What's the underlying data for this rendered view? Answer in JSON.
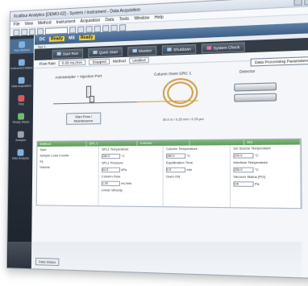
{
  "window": {
    "title": "Xcalibur Analytics [DEMO-02] - System / Instrument - Data Acquisition",
    "menu": [
      "File",
      "View",
      "Method",
      "Instrument",
      "Acquisition",
      "Data",
      "Tools",
      "Window",
      "Help"
    ]
  },
  "sidebar": {
    "items": [
      {
        "label": "New Method",
        "icon": "document-icon"
      },
      {
        "label": "Instrument Status",
        "icon": "instrument-icon"
      },
      {
        "label": "Data Acquisition",
        "icon": "acquisition-icon"
      },
      {
        "label": "Stop",
        "icon": "stop-icon"
      },
      {
        "label": "Ready Status",
        "icon": "status-icon"
      },
      {
        "label": "Analysis",
        "icon": "analysis-icon"
      },
      {
        "label": "Data Analysis",
        "icon": "chart-icon"
      }
    ]
  },
  "status": {
    "prefix": "DC",
    "state1": "Ready",
    "mid": "MS",
    "state2": "Ready",
    "sub": "Sys 1"
  },
  "buttons": {
    "run": "Start Run",
    "quick": "Quick Start",
    "monitor": "Monitor",
    "shutdown": "Shutdown",
    "check": "System Check"
  },
  "info": {
    "flow_label": "Flow Rate",
    "flow_value": "0.00 mL/min",
    "state_label": "Stopped",
    "method_label": "Method",
    "method_value": "Untitled"
  },
  "data_processing_button": "Data Processing Parameters...",
  "diagram": {
    "autosampler": "Autosampler + Injection Port",
    "column": "Column Oven GRC 1",
    "detector": "Detector",
    "inject_button": "Start Flow / Maintenance",
    "column_note": "30.0 m / 0.25 mm / 0.25 µm"
  },
  "params": {
    "headers": [
      "Method",
      "SPL 1",
      "Column",
      "",
      "MS"
    ],
    "col1": {
      "line1": "Start",
      "line2": "Sample Load Counts",
      "line3": "Inj",
      "line4": "Volume"
    },
    "col2": {
      "line1": "SPL1 Temperature",
      "v1": "280.0",
      "u1": "°C",
      "line2": "SPL1 Pressure",
      "v2": "62.8",
      "u2": "kPa",
      "line3": "Column Flow",
      "v3": "1.00",
      "u3": "mL/min",
      "line4": "Linear Velocity"
    },
    "col3": {
      "line1": "Column Temperature",
      "v1": "280.0",
      "u1": "°C",
      "line2": "Equilibration Time",
      "v2": "0.5",
      "u2": "min",
      "line3": "Oven ON"
    },
    "col4": {
      "line1": "Ion Source Temperature",
      "v1": "200.0",
      "u1": "°C",
      "line2": "Interface Temperature",
      "v2": "250.0",
      "u2": "°C",
      "line3": "Vacuum Status (PG)",
      "v3": "OK",
      "u3": "Pa"
    }
  },
  "bottom_tab": "Data Status",
  "colors": {
    "accent": "#3f6088",
    "ready_badge": "#f3d33a",
    "param_header": "#5e9b59",
    "coil": "#d2a24c"
  }
}
